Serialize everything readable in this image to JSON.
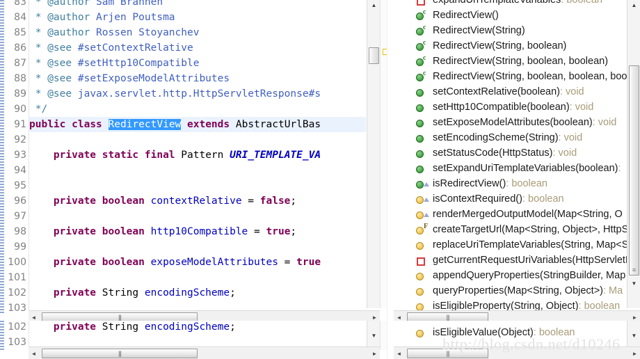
{
  "editor": {
    "name": "java-source-editor",
    "language": "Java",
    "first_visible_line": 83,
    "lines": [
      {
        "num": 83,
        "segments": [
          {
            "t": " * ",
            "c": "cm"
          },
          {
            "t": "@author",
            "c": "cm"
          },
          {
            "t": " Sam Brannen",
            "c": "cmt"
          }
        ]
      },
      {
        "num": 84,
        "segments": [
          {
            "t": " * ",
            "c": "cm"
          },
          {
            "t": "@author",
            "c": "cm"
          },
          {
            "t": " Arjen Poutsma",
            "c": "cmt"
          }
        ]
      },
      {
        "num": 85,
        "segments": [
          {
            "t": " * ",
            "c": "cm"
          },
          {
            "t": "@author",
            "c": "cm"
          },
          {
            "t": " Rossen Stoyanchev",
            "c": "cmt"
          }
        ]
      },
      {
        "num": 86,
        "segments": [
          {
            "t": " * ",
            "c": "cm"
          },
          {
            "t": "@see",
            "c": "cm"
          },
          {
            "t": " #setContextRelative",
            "c": "cmt"
          }
        ]
      },
      {
        "num": 87,
        "segments": [
          {
            "t": " * ",
            "c": "cm"
          },
          {
            "t": "@see",
            "c": "cm"
          },
          {
            "t": " #setHttp10Compatible",
            "c": "cmt"
          }
        ]
      },
      {
        "num": 88,
        "segments": [
          {
            "t": " * ",
            "c": "cm"
          },
          {
            "t": "@see",
            "c": "cm"
          },
          {
            "t": " #setExposeModelAttributes",
            "c": "cmt"
          }
        ]
      },
      {
        "num": 89,
        "segments": [
          {
            "t": " * ",
            "c": "cm"
          },
          {
            "t": "@see",
            "c": "cm"
          },
          {
            "t": " javax.servlet.http.HttpServletResponse#s",
            "c": "cmt"
          }
        ]
      },
      {
        "num": 90,
        "segments": [
          {
            "t": " */",
            "c": "cm"
          }
        ]
      },
      {
        "num": 91,
        "highlight": true,
        "segments": [
          {
            "t": "public",
            "c": "k"
          },
          {
            "t": " ",
            "c": "typ"
          },
          {
            "t": "class",
            "c": "k"
          },
          {
            "t": " ",
            "c": "typ"
          },
          {
            "t": "RedirectView",
            "c": "sel"
          },
          {
            "t": " ",
            "c": "typ"
          },
          {
            "t": "extends",
            "c": "k"
          },
          {
            "t": " AbstractUrlBas",
            "c": "typ"
          }
        ]
      },
      {
        "num": 92,
        "segments": []
      },
      {
        "num": 93,
        "segments": [
          {
            "t": "\t",
            "c": "typ"
          },
          {
            "t": "private",
            "c": "k"
          },
          {
            "t": " ",
            "c": "typ"
          },
          {
            "t": "static",
            "c": "k"
          },
          {
            "t": " ",
            "c": "typ"
          },
          {
            "t": "final",
            "c": "k"
          },
          {
            "t": " Pattern ",
            "c": "typ"
          },
          {
            "t": "URI_TEMPLATE_VA",
            "c": "sfld"
          }
        ]
      },
      {
        "num": 94,
        "segments": []
      },
      {
        "num": 95,
        "segments": []
      },
      {
        "num": 96,
        "segments": [
          {
            "t": "\t",
            "c": "typ"
          },
          {
            "t": "private",
            "c": "k"
          },
          {
            "t": " ",
            "c": "typ"
          },
          {
            "t": "boolean",
            "c": "k"
          },
          {
            "t": " ",
            "c": "typ"
          },
          {
            "t": "contextRelative",
            "c": "fld"
          },
          {
            "t": " = ",
            "c": "typ"
          },
          {
            "t": "false",
            "c": "k"
          },
          {
            "t": ";",
            "c": "typ"
          }
        ]
      },
      {
        "num": 97,
        "segments": []
      },
      {
        "num": 98,
        "segments": [
          {
            "t": "\t",
            "c": "typ"
          },
          {
            "t": "private",
            "c": "k"
          },
          {
            "t": " ",
            "c": "typ"
          },
          {
            "t": "boolean",
            "c": "k"
          },
          {
            "t": " ",
            "c": "typ"
          },
          {
            "t": "http10Compatible",
            "c": "fld"
          },
          {
            "t": " = ",
            "c": "typ"
          },
          {
            "t": "true",
            "c": "k"
          },
          {
            "t": ";",
            "c": "typ"
          }
        ]
      },
      {
        "num": 99,
        "segments": []
      },
      {
        "num": 100,
        "segments": [
          {
            "t": "\t",
            "c": "typ"
          },
          {
            "t": "private",
            "c": "k"
          },
          {
            "t": " ",
            "c": "typ"
          },
          {
            "t": "boolean",
            "c": "k"
          },
          {
            "t": " ",
            "c": "typ"
          },
          {
            "t": "exposeModelAttributes",
            "c": "fld"
          },
          {
            "t": " = ",
            "c": "typ"
          },
          {
            "t": "true",
            "c": "k"
          }
        ]
      },
      {
        "num": 101,
        "segments": []
      },
      {
        "num": 102,
        "segments": [
          {
            "t": "\t",
            "c": "typ"
          },
          {
            "t": "private",
            "c": "k"
          },
          {
            "t": " String ",
            "c": "typ"
          },
          {
            "t": "encodingScheme",
            "c": "fld"
          },
          {
            "t": ";",
            "c": "typ"
          }
        ]
      },
      {
        "num": 103,
        "segments": []
      }
    ],
    "duplicate_strip": {
      "lines": [
        {
          "num": 102,
          "segments": [
            {
              "t": "\t",
              "c": "typ"
            },
            {
              "t": "private",
              "c": "k"
            },
            {
              "t": " String ",
              "c": "typ"
            },
            {
              "t": "encodingScheme",
              "c": "fld"
            },
            {
              "t": ";",
              "c": "typ"
            }
          ]
        },
        {
          "num": 103,
          "segments": []
        }
      ]
    }
  },
  "outline": {
    "name": "outline-view",
    "items": [
      {
        "label": "expandUriTemplateVariables",
        "type": " : boolean",
        "marker": "red-square",
        "deco": ""
      },
      {
        "label": "RedirectView()",
        "type": "",
        "marker": "green-dot",
        "deco": "c"
      },
      {
        "label": "RedirectView(String)",
        "type": "",
        "marker": "green-dot",
        "deco": "c"
      },
      {
        "label": "RedirectView(String, boolean)",
        "type": "",
        "marker": "green-dot",
        "deco": "c"
      },
      {
        "label": "RedirectView(String, boolean, boolean)",
        "type": "",
        "marker": "green-dot",
        "deco": "c"
      },
      {
        "label": "RedirectView(String, boolean, boolean, boo",
        "type": "",
        "marker": "green-dot",
        "deco": "c"
      },
      {
        "label": "setContextRelative(boolean)",
        "type": " : void",
        "marker": "green-dot",
        "deco": ""
      },
      {
        "label": "setHttp10Compatible(boolean)",
        "type": " : void",
        "marker": "green-dot",
        "deco": ""
      },
      {
        "label": "setExposeModelAttributes(boolean)",
        "type": " : void",
        "marker": "green-dot",
        "deco": ""
      },
      {
        "label": "setEncodingScheme(String)",
        "type": " : void",
        "marker": "green-dot",
        "deco": ""
      },
      {
        "label": "setStatusCode(HttpStatus)",
        "type": " : void",
        "marker": "green-dot",
        "deco": ""
      },
      {
        "label": "setExpandUriTemplateVariables(boolean)",
        "type": " : ",
        "marker": "green-dot",
        "deco": ""
      },
      {
        "label": "isRedirectView()",
        "type": " : boolean",
        "marker": "green-dot",
        "deco": "triangle"
      },
      {
        "label": "isContextRequired()",
        "type": " : boolean",
        "marker": "yellow-dot",
        "deco": "triangle"
      },
      {
        "label": "renderMergedOutputModel(Map<String, O",
        "type": "",
        "marker": "yellow-dot",
        "deco": "triangle"
      },
      {
        "label": "createTargetUrl(Map<String, Object>, HttpS",
        "type": "",
        "marker": "yellow-dot",
        "deco": "F"
      },
      {
        "label": "replaceUriTemplateVariables(String, Map<S",
        "type": "",
        "marker": "yellow-dot",
        "deco": ""
      },
      {
        "label": "getCurrentRequestUriVariables(HttpServletR",
        "type": "",
        "marker": "red-square",
        "deco": ""
      },
      {
        "label": "appendQueryProperties(StringBuilder, Map",
        "type": "",
        "marker": "yellow-dot",
        "deco": ""
      },
      {
        "label": "queryProperties(Map<String, Object>)",
        "type": " : Ma",
        "marker": "yellow-dot",
        "deco": ""
      },
      {
        "label": "isEligibleProperty(String, Object)",
        "type": " : boolean",
        "marker": "yellow-dot",
        "deco": ""
      },
      {
        "label": "isEligibleValue(Object)",
        "type": " : boolean",
        "marker": "yellow-dot",
        "deco": ""
      },
      {
        "label": "isEligibleProperty(String, Object) : boolean",
        "type": "",
        "marker": "yellow-dot",
        "deco": ""
      }
    ],
    "duplicate_strip": {
      "items": [
        {
          "label": "isEligibleValue(Object)",
          "type": " : boolean",
          "marker": "yellow-dot",
          "deco": ""
        }
      ]
    }
  },
  "scrollbars": {
    "editor_vertical": {
      "up_arrow": "▲",
      "down_arrow": "▼"
    },
    "editor_horizontal": {
      "left_arrow": "◄",
      "right_arrow": "►",
      "grip": "|||"
    },
    "outline_vertical": {
      "up_arrow": "▲",
      "down_arrow": "▼",
      "grip": "≡"
    },
    "outline_horizontal": {
      "left_arrow": "◄",
      "right_arrow": "►",
      "grip": "|||"
    }
  },
  "watermark": {
    "text": "http://blog.csdn.net/d10246"
  },
  "colors": {
    "keyword": "#7f0055",
    "javadoc_tag": "#3f7f9f",
    "javadoc_text": "#3f5fbf",
    "field": "#0000c0",
    "selection": "#3399ff",
    "line_highlight": "#eaf2fe",
    "outline_type": "#a89b78",
    "green_marker": "#239023",
    "yellow_marker": "#e8b73a",
    "red_marker": "#d63b3b"
  }
}
